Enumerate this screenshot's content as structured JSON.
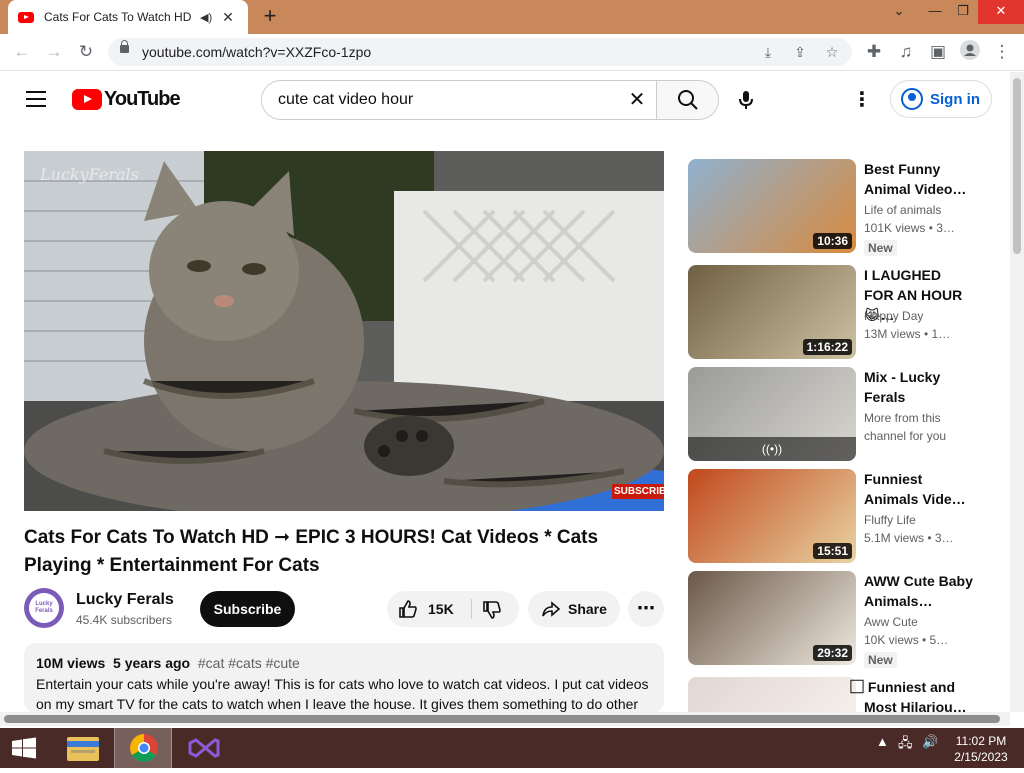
{
  "browser": {
    "tab_title": "Cats For Cats To Watch HD -",
    "url": "youtube.com/watch?v=XXZFco-1zpo",
    "icons": [
      "youtube-favicon",
      "audio-icon",
      "close-icon",
      "plus-icon",
      "back-icon",
      "forward-icon",
      "reload-icon",
      "lock-icon",
      "install-icon",
      "share-icon",
      "star-icon",
      "extensions-icon",
      "media-icon",
      "sidebar-icon",
      "profile-icon",
      "menu-icon"
    ]
  },
  "youtube": {
    "logo_text": "YouTube",
    "search_value": "cute cat video hour",
    "sign_in": "Sign in"
  },
  "player": {
    "watermark": "LuckyFerals",
    "subscribe_overlay": "SUBSCRIBE"
  },
  "video": {
    "title": "Cats For Cats To Watch HD ➞ EPIC 3 HOURS! Cat Videos * Cats Playing * Entertainment For Cats",
    "channel_name": "Lucky Ferals",
    "channel_avatar_text": "Lucky Ferals",
    "subscribers": "45.4K subscribers",
    "subscribe_label": "Subscribe",
    "likes": "15K",
    "share_label": "Share",
    "views": "10M views",
    "age": "5 years ago",
    "tags": "#cat #cats #cute",
    "description": "Entertain your cats while you're away! This is for cats who love to watch cat videos. I put cat videos on my smart TV for the cats to watch when I leave the house. It gives them something to do other"
  },
  "related": [
    {
      "title": "Best Funny Animal Video…",
      "channel": "Life of animals",
      "views": "101K views  • 3…",
      "duration": "10:36",
      "badge": "New",
      "colors": [
        "#8fb1cf",
        "#d98a3d"
      ]
    },
    {
      "title": "I LAUGHED FOR AN HOUR😹…",
      "channel": "Happy Day",
      "views": "13M views  • 1…",
      "duration": "1:16:22",
      "badge": "",
      "colors": [
        "#6f6044",
        "#cfc2a3"
      ]
    },
    {
      "title": "Mix - Lucky Ferals",
      "channel": "More from this",
      "views": "channel for you",
      "duration": "",
      "badge": "",
      "mix_icon": "((•))",
      "colors": [
        "#9a9a98",
        "#d8d6d0"
      ]
    },
    {
      "title": "Funniest Animals Vide…",
      "channel": "Fluffy Life",
      "views": "5.1M views  • 3…",
      "duration": "15:51",
      "badge": "",
      "colors": [
        "#c0481c",
        "#e9d3a2"
      ]
    },
    {
      "title": "AWW Cute Baby Animals…",
      "channel": "Aww Cute",
      "views": "10K views  • 5…",
      "duration": "29:32",
      "badge": "New",
      "colors": [
        "#6a5848",
        "#efe8df"
      ]
    },
    {
      "title": "⃞ Funniest and Most Hilariou…",
      "channel": "",
      "views": "",
      "duration": "",
      "badge": "",
      "colors": [
        "#e2d7d2",
        "#f5eeea"
      ]
    }
  ],
  "taskbar": {
    "time": "11:02 PM",
    "date": "2/15/2023",
    "apps": [
      "windows-start-icon",
      "file-explorer-icon",
      "chrome-icon",
      "visual-studio-icon"
    ]
  }
}
